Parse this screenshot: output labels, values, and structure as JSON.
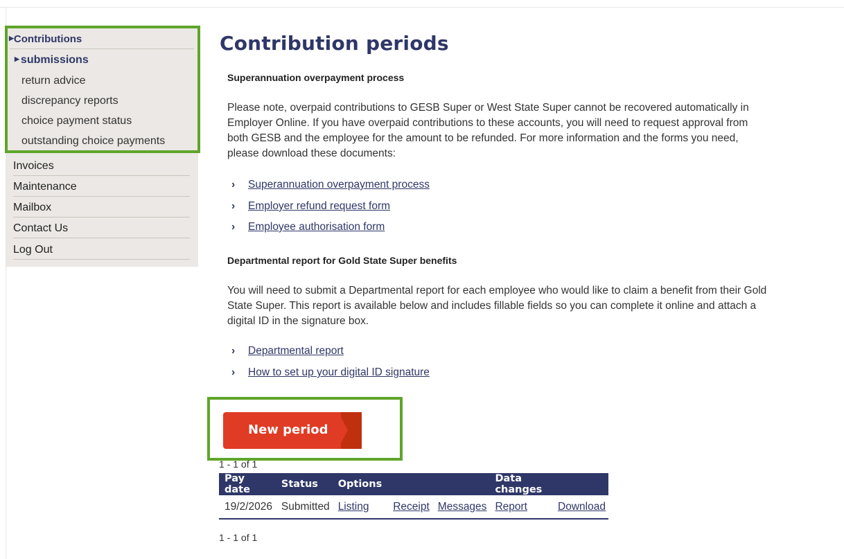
{
  "sidebar": {
    "section_title": "Contributions",
    "sub_items": [
      {
        "label": "submissions",
        "active": true
      },
      {
        "label": "return advice"
      },
      {
        "label": "discrepancy reports"
      },
      {
        "label": "choice payment status"
      },
      {
        "label": "outstanding choice payments"
      }
    ],
    "items": [
      {
        "label": "Invoices"
      },
      {
        "label": "Maintenance"
      },
      {
        "label": "Mailbox"
      },
      {
        "label": "Contact Us"
      },
      {
        "label": "Log Out"
      }
    ]
  },
  "main": {
    "title": "Contribution periods",
    "overpayment": {
      "heading": "Superannuation overpayment process",
      "lines": [
        "Please note, overpaid contributions to GESB Super or West State Super cannot be recovered automatically in",
        "Employer Online. If you have overpaid contributions to these accounts, you will need to request approval from",
        "both GESB and the employee for the amount to be refunded. For more information and the forms you need,",
        "please download these documents:"
      ],
      "links": [
        "Superannuation overpayment process",
        "Employer refund request form",
        "Employee authorisation form"
      ]
    },
    "departmental": {
      "heading": "Departmental report for Gold State Super benefits",
      "lines": [
        "You will need to submit a Departmental report for each employee who would like to claim a benefit from their Gold",
        "State Super. This report is available below and includes fillable fields so you can complete it online and attach a",
        "digital ID in the signature box."
      ],
      "links": [
        "Departmental report",
        "How to set up your digital ID signature"
      ]
    },
    "new_period_label": "New period",
    "count_top": "1 - 1 of 1",
    "count_bottom": "1 - 1 of 1",
    "table": {
      "headers": [
        "Pay date",
        "Status",
        "Options",
        "",
        "",
        "Data changes",
        ""
      ],
      "row": {
        "pay_date": "19/2/2026",
        "status": "Submitted",
        "listing": "Listing",
        "receipt": "Receipt",
        "messages": "Messages",
        "report": "Report",
        "download": "Download"
      }
    }
  },
  "colors": {
    "accent_navy": "#2f3768",
    "button_red": "#e03b25",
    "highlight_green": "#5fa52a",
    "sidebar_bg": "#ebe8e5"
  }
}
